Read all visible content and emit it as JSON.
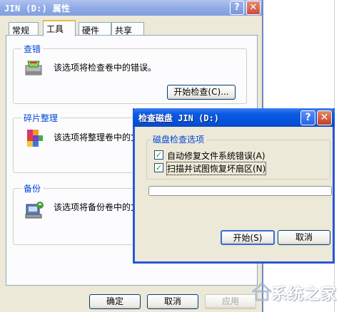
{
  "window": {
    "title": "JIN (D:) 属性",
    "help_glyph": "?",
    "close_glyph": "✕"
  },
  "tabs": [
    {
      "label": "常规",
      "active": false
    },
    {
      "label": "工具",
      "active": true
    },
    {
      "label": "硬件",
      "active": false
    },
    {
      "label": "共享",
      "active": false
    }
  ],
  "sections": {
    "check": {
      "title": "查错",
      "description": "该选项将检查卷中的错误。",
      "button": "开始检查(C)..."
    },
    "defrag": {
      "title": "碎片整理",
      "description": "该选项将整理卷中的文"
    },
    "backup": {
      "title": "备份",
      "description": "该选项将备份卷中的文"
    }
  },
  "footer": {
    "ok": "确定",
    "cancel": "取消",
    "apply": "应用"
  },
  "dialog": {
    "title": "检查磁盘 JIN (D:)",
    "help_glyph": "?",
    "close_glyph": "✕",
    "group_title": "磁盘检查选项",
    "options": [
      {
        "label": "自动修复文件系统错误(A)",
        "checked": true
      },
      {
        "label": "扫描并试图恢复坏扇区(N)",
        "checked": true
      }
    ],
    "check_glyph": "✓",
    "progress": 0,
    "start": "开始(S)",
    "cancel": "取消"
  },
  "watermark": {
    "text": "系统之家"
  },
  "colors": {
    "group_title": "#0046d5",
    "dialog_title_bar": "#0552dc",
    "dialog_border": "#2a56d8",
    "active_tab_accent": "#f0b841"
  }
}
